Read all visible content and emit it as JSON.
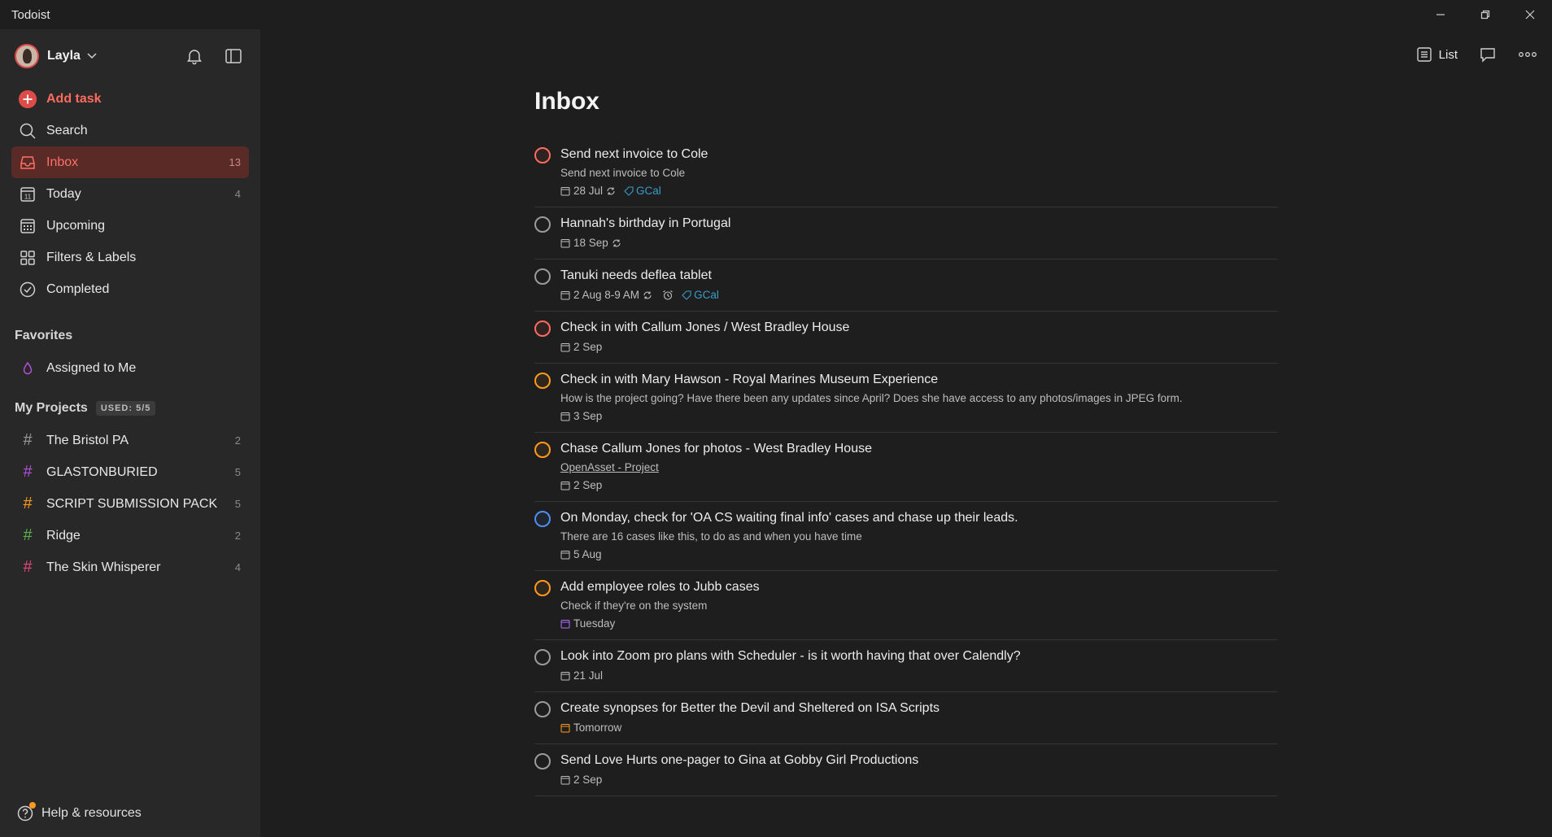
{
  "window": {
    "title": "Todoist"
  },
  "sidebar": {
    "user": "Layla",
    "add_task": "Add task",
    "nav": [
      {
        "label": "Search",
        "count": ""
      },
      {
        "label": "Inbox",
        "count": "13"
      },
      {
        "label": "Today",
        "count": "4"
      },
      {
        "label": "Upcoming",
        "count": ""
      },
      {
        "label": "Filters & Labels",
        "count": ""
      },
      {
        "label": "Completed",
        "count": ""
      }
    ],
    "favorites_heading": "Favorites",
    "favorites": [
      {
        "label": "Assigned to Me",
        "color": "#b14fd6"
      }
    ],
    "projects_heading": "My Projects",
    "projects_used": "USED: 5/5",
    "projects": [
      {
        "label": "The Bristol PA",
        "count": "2",
        "color": "#9b9b9b"
      },
      {
        "label": "GLASTONBURIED",
        "count": "5",
        "color": "#b14fd6"
      },
      {
        "label": "SCRIPT SUBMISSION PACK",
        "count": "5",
        "color": "#ff9a1f"
      },
      {
        "label": "Ridge",
        "count": "2",
        "color": "#5ab04a"
      },
      {
        "label": "The Skin Whisperer",
        "count": "4",
        "color": "#e0457b"
      }
    ],
    "help": "Help & resources"
  },
  "header": {
    "view_label": "List"
  },
  "main": {
    "title": "Inbox",
    "tasks": [
      {
        "title": "Send next invoice to Cole",
        "desc": "Send next invoice to Cole",
        "date": "28 Jul",
        "recurring": true,
        "label": "GCal",
        "priority": "p1"
      },
      {
        "title": "Hannah's birthday in Portugal",
        "date": "18 Sep",
        "recurring": true,
        "priority": "p4"
      },
      {
        "title": "Tanuki needs deflea tablet",
        "date": "2 Aug 8-9 AM",
        "recurring": true,
        "reminder": true,
        "label": "GCal",
        "priority": "p4"
      },
      {
        "title": "Check in with Callum Jones / West Bradley House",
        "date": "2 Sep",
        "priority": "p1"
      },
      {
        "title": "Check in with Mary Hawson - Royal Marines Museum Experience",
        "desc": "How is the project going? Have there been any updates since April? Does she have access to any photos/images in JPEG form.",
        "date": "3 Sep",
        "priority": "p2"
      },
      {
        "title": "Chase Callum Jones for photos - West Bradley House",
        "link": "OpenAsset - Project",
        "date": "2 Sep",
        "priority": "p2"
      },
      {
        "title": "On Monday, check for 'OA CS waiting final info' cases and chase up their leads.",
        "desc": "There are 16 cases like this, to do as and when you have time",
        "date": "5 Aug",
        "priority": "p3"
      },
      {
        "title": "Add employee roles to Jubb cases",
        "desc": "Check if they're on the system",
        "date": "Tuesday",
        "date_color": "purple",
        "priority": "p2"
      },
      {
        "title": "Look into Zoom pro plans with Scheduler - is it worth having that over Calendly?",
        "date": "21 Jul",
        "priority": "p4"
      },
      {
        "title": "Create synopses for Better the Devil and Sheltered on ISA Scripts",
        "date": "Tomorrow",
        "date_color": "orange",
        "priority": "p4"
      },
      {
        "title": "Send Love Hurts one-pager to Gina at Gobby Girl Productions",
        "date": "2 Sep",
        "priority": "p4"
      }
    ]
  }
}
